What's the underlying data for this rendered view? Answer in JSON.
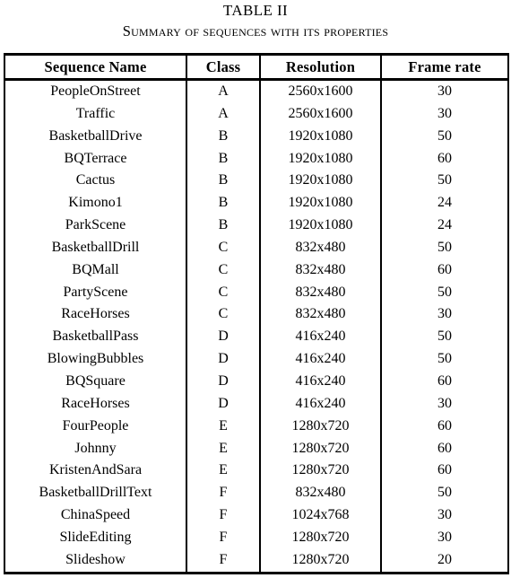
{
  "caption": {
    "number_line": "TABLE II",
    "title_line": "Summary of sequences with its properties"
  },
  "table": {
    "columns": [
      {
        "key": "name",
        "label": "Sequence  Name"
      },
      {
        "key": "class",
        "label": "Class"
      },
      {
        "key": "resolution",
        "label": "Resolution"
      },
      {
        "key": "frame_rate",
        "label": "Frame  rate"
      }
    ],
    "rows": [
      {
        "name": "PeopleOnStreet",
        "class": "A",
        "resolution": "2560x1600",
        "frame_rate": "30"
      },
      {
        "name": "Traffic",
        "class": "A",
        "resolution": "2560x1600",
        "frame_rate": "30"
      },
      {
        "name": "BasketballDrive",
        "class": "B",
        "resolution": "1920x1080",
        "frame_rate": "50"
      },
      {
        "name": "BQTerrace",
        "class": "B",
        "resolution": "1920x1080",
        "frame_rate": "60"
      },
      {
        "name": "Cactus",
        "class": "B",
        "resolution": "1920x1080",
        "frame_rate": "50"
      },
      {
        "name": "Kimono1",
        "class": "B",
        "resolution": "1920x1080",
        "frame_rate": "24"
      },
      {
        "name": "ParkScene",
        "class": "B",
        "resolution": "1920x1080",
        "frame_rate": "24"
      },
      {
        "name": "BasketballDrill",
        "class": "C",
        "resolution": "832x480",
        "frame_rate": "50"
      },
      {
        "name": "BQMall",
        "class": "C",
        "resolution": "832x480",
        "frame_rate": "60"
      },
      {
        "name": "PartyScene",
        "class": "C",
        "resolution": "832x480",
        "frame_rate": "50"
      },
      {
        "name": "RaceHorses",
        "class": "C",
        "resolution": "832x480",
        "frame_rate": "30"
      },
      {
        "name": "BasketballPass",
        "class": "D",
        "resolution": "416x240",
        "frame_rate": "50"
      },
      {
        "name": "BlowingBubbles",
        "class": "D",
        "resolution": "416x240",
        "frame_rate": "50"
      },
      {
        "name": "BQSquare",
        "class": "D",
        "resolution": "416x240",
        "frame_rate": "60"
      },
      {
        "name": "RaceHorses",
        "class": "D",
        "resolution": "416x240",
        "frame_rate": "30"
      },
      {
        "name": "FourPeople",
        "class": "E",
        "resolution": "1280x720",
        "frame_rate": "60"
      },
      {
        "name": "Johnny",
        "class": "E",
        "resolution": "1280x720",
        "frame_rate": "60"
      },
      {
        "name": "KristenAndSara",
        "class": "E",
        "resolution": "1280x720",
        "frame_rate": "60"
      },
      {
        "name": "BasketballDrillText",
        "class": "F",
        "resolution": "832x480",
        "frame_rate": "50"
      },
      {
        "name": "ChinaSpeed",
        "class": "F",
        "resolution": "1024x768",
        "frame_rate": "30"
      },
      {
        "name": "SlideEditing",
        "class": "F",
        "resolution": "1280x720",
        "frame_rate": "30"
      },
      {
        "name": "Slideshow",
        "class": "F",
        "resolution": "1280x720",
        "frame_rate": "20"
      }
    ]
  }
}
